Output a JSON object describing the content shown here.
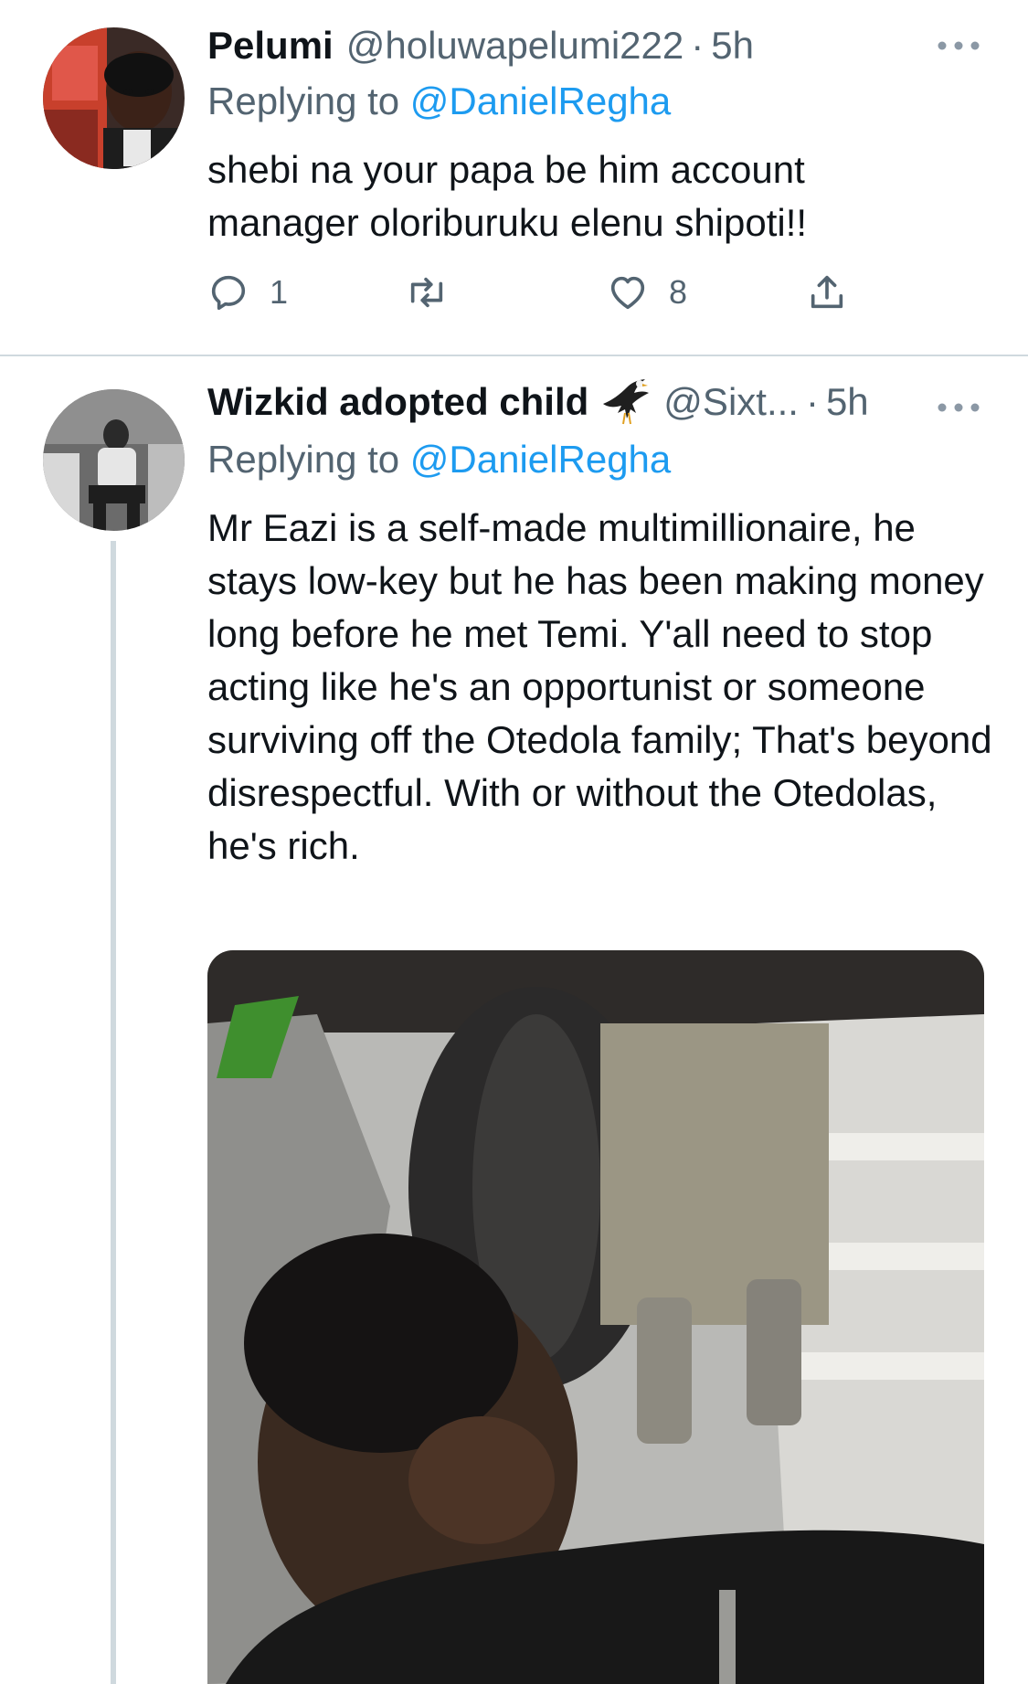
{
  "tweets": [
    {
      "name": "Pelumi",
      "handle": "@holuwapelumi222",
      "time": "5h",
      "replying_prefix": "Replying to",
      "replying_to": "@DanielRegha",
      "text": "shebi na your papa be him account manager oloriburuku elenu shipoti!!",
      "reply_count": "1",
      "retweet_count": "",
      "like_count": "8",
      "avatar_icon": "profile-photo-man"
    },
    {
      "name": "Wizkid adopted child",
      "name_emoji_icon": "eagle-icon",
      "handle": "@Sixt...",
      "time": "5h",
      "replying_prefix": "Replying to",
      "replying_to": "@DanielRegha",
      "text": "Mr Eazi is a self-made multimillionaire, he stays low-key but he has been making money long before he met Temi. Y'all need to stop acting like he's an opportunist or someone surviving off the Otedola family; That's beyond disrespectful. With or without the Otedolas, he's rich.",
      "avatar_icon": "profile-photo-sitting-man",
      "media_icon": "photo-man-under-vehicle"
    }
  ],
  "separator": "·",
  "colors": {
    "link": "#1d9bf0",
    "secondary_text": "#536471",
    "divider": "#cfd9de"
  }
}
